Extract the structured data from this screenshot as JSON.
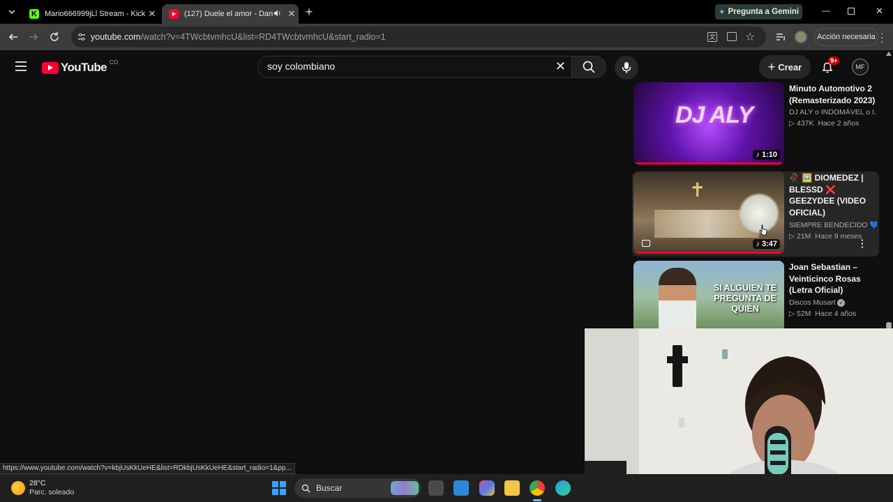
{
  "browser": {
    "tabs": [
      {
        "title": "Mario666999jLl Stream - Kick D",
        "active": false
      },
      {
        "title": "(127) Duele el amor - Danil",
        "active": true
      }
    ],
    "url_host": "youtube.com",
    "url_path": "/watch?v=4TWcbtvmhcU&list=RD4TWcbtvmhcU&start_radio=1",
    "gemini_label": "Pregunta a Gemini",
    "account_status": "Acción necesaria",
    "status_url": "https://www.youtube.com/watch?v=kbjUsKkUeHE&list=RDkbjUsKkUeHE&start_radio=1&pp..."
  },
  "youtube": {
    "logo_text": "YouTube",
    "country_code": "CO",
    "search_value": "soy colombiano",
    "create_label": "Crear",
    "notif_count": "9+",
    "avatar_initials": "MF"
  },
  "sidebar_videos": [
    {
      "title": "Minuto Automotivo 2 (Remasterizado 2023)",
      "channel": "DJ ALY o INDOMÁVEL o I...",
      "views": "437K",
      "age": "Hace 2 años",
      "duration": "1:10",
      "thumb_text": "DJ ALY"
    },
    {
      "title": "DIOMEDEZ | BLESSD ❌ GEEZYDEE (VIDEO OFICIAL)",
      "channel": "SIEMPRE BENDECIDO 💙",
      "views": "21M",
      "age": "Hace 9 meses",
      "duration": "3:47"
    },
    {
      "title": "Joan Sebastian – Veinticinco Rosas (Letra Oficial)",
      "channel": "Discos Musart",
      "views": "52M",
      "age": "Hace 4 años",
      "thumb_text": "SI ALGUIEN TE PREGUNTA DE QUIÉN"
    }
  ],
  "taskbar": {
    "temperature": "28°C",
    "weather": "Parc. soleado",
    "search_label": "Buscar"
  },
  "colors": {
    "accent": "#ff0033",
    "bg": "#0f0f0f"
  }
}
